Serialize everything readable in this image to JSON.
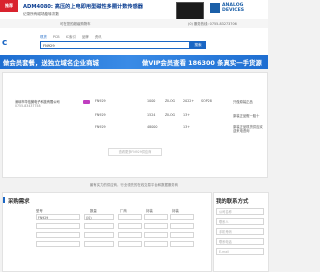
{
  "ad": {
    "tag": "推荐",
    "title": "ADM4080: 高压的上电即用型磁性多圈计数传感器",
    "subtitle": "记录所有磁场旋转次数",
    "brand_line1": "ANALOG",
    "brand_line2": "DEVICES"
  },
  "utility": {
    "left": "可在您的超级购物车",
    "right": "(0)   服务热线: 0755-83273706"
  },
  "header": {
    "logo": "c",
    "tabs": [
      "现货",
      "PCB",
      "IC索引",
      "品牌",
      "资讯"
    ],
    "search_value": "FN929",
    "search_button": "搜索"
  },
  "banners": {
    "left": "做会员套餐，送独立域名企业商城",
    "right": "做VIP会员查看 186300 条真实一手货源"
  },
  "listing": {
    "seller_name": "深圳市华信微电子科技有限公司",
    "seller_tel": "0755-83437758",
    "rows": [
      {
        "model": "FN929",
        "qty": "1000",
        "brand": "ZILOG",
        "pkg": "2022+",
        "pack": "SOP28",
        "note": "只做原装正品"
      },
      {
        "model": "FN929",
        "qty": "1524",
        "brand": "ZILOG",
        "pkg": "13+",
        "pack": "",
        "note": "原装正品假一赔十"
      },
      {
        "model": "FN929",
        "qty": "48000",
        "brand": "",
        "pkg": "13+",
        "pack": "",
        "note": "原装正品现货供应欢迎来电咨询"
      }
    ],
    "more": "查看更多FN929供应商"
  },
  "notice": "最有实力的供应商，行业领先的在线交易平台和数据服务商",
  "form": {
    "title": "采购需求",
    "headers": [
      "型号",
      "数量",
      "厂商",
      "封装",
      "封装"
    ],
    "row1_model": "FN929",
    "row1_unit": "(片)"
  },
  "contact": {
    "title": "我的联系方式",
    "fields": [
      "公司名称",
      "联系人",
      "手机号码",
      "联系电话",
      "E-mail"
    ]
  }
}
